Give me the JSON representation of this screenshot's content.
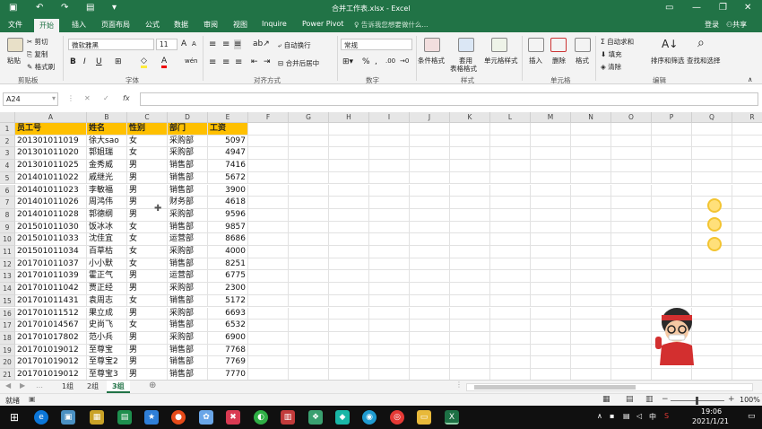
{
  "window": {
    "title": "合并工作表.xlsx - Excel",
    "signin": "登录",
    "share": "共享"
  },
  "tabs": [
    "文件",
    "开始",
    "插入",
    "页面布局",
    "公式",
    "数据",
    "审阅",
    "视图",
    "Inquire",
    "Power Pivot"
  ],
  "active_tab": "开始",
  "tellme_placeholder": "告诉我您想要做什么...",
  "ribbon": {
    "clipboard": {
      "paste": "粘贴",
      "cut": "剪切",
      "copy": "复制",
      "format_painter": "格式刷",
      "group": "剪贴板"
    },
    "font": {
      "name": "微软雅黑",
      "size": "11",
      "bold": "B",
      "italic": "I",
      "underline": "U",
      "fill_letter": "A",
      "group": "字体",
      "grow": "A",
      "shrink": "A",
      "wen": "wén"
    },
    "alignment": {
      "wrap": "自动换行",
      "merge": "合并后居中",
      "group": "对齐方式"
    },
    "number": {
      "format": "常规",
      "group": "数字"
    },
    "styles": {
      "conditional": "条件格式",
      "table1": "套用",
      "table2": "表格格式",
      "cell_styles": "单元格样式",
      "group": "样式"
    },
    "cells": {
      "insert": "插入",
      "delete": "删除",
      "format": "格式",
      "group": "单元格"
    },
    "editing": {
      "autosum": "自动求和",
      "fill": "填充",
      "clear": "清除",
      "sort": "排序和筛选",
      "find": "查找和选择",
      "group": "编辑"
    }
  },
  "formula_bar": {
    "name_box": "A24",
    "value": ""
  },
  "columns": [
    "A",
    "B",
    "C",
    "D",
    "E",
    "F",
    "G",
    "H",
    "I",
    "J",
    "K",
    "L",
    "M",
    "N",
    "O",
    "P",
    "Q",
    "R"
  ],
  "row_numbers": [
    "1",
    "2",
    "3",
    "4",
    "5",
    "6",
    "7",
    "8",
    "9",
    "10",
    "11",
    "12",
    "13",
    "14",
    "15",
    "16",
    "17",
    "18",
    "19",
    "20",
    "21"
  ],
  "table": {
    "headers": [
      "员工号",
      "姓名",
      "性别",
      "部门",
      "工资"
    ],
    "rows": [
      [
        "201301011019",
        "徐大sao",
        "女",
        "采购部",
        "5097"
      ],
      [
        "201301011020",
        "郭姐瑞",
        "女",
        "采购部",
        "4947"
      ],
      [
        "201301011025",
        "金秀威",
        "男",
        "销售部",
        "7416"
      ],
      [
        "201401011022",
        "戚继光",
        "男",
        "销售部",
        "5672"
      ],
      [
        "201401011023",
        "李敏福",
        "男",
        "销售部",
        "3900"
      ],
      [
        "201401011026",
        "周鸿伟",
        "男",
        "财务部",
        "4618"
      ],
      [
        "201401011028",
        "郭德纲",
        "男",
        "采购部",
        "9596"
      ],
      [
        "201501011030",
        "饭冰冰",
        "女",
        "销售部",
        "9857"
      ],
      [
        "201501011033",
        "沈佳宜",
        "女",
        "运营部",
        "8686"
      ],
      [
        "201501011034",
        "百草枯",
        "女",
        "采购部",
        "4000"
      ],
      [
        "201701011037",
        "小小默",
        "女",
        "销售部",
        "8251"
      ],
      [
        "201701011039",
        "霍正气",
        "男",
        "运营部",
        "6775"
      ],
      [
        "201701011042",
        "贾正经",
        "男",
        "采购部",
        "2300"
      ],
      [
        "201701011431",
        "袁周志",
        "女",
        "销售部",
        "5172"
      ],
      [
        "201701011512",
        "果立成",
        "男",
        "采购部",
        "6693"
      ],
      [
        "201701014567",
        "史尚飞",
        "女",
        "销售部",
        "6532"
      ],
      [
        "201701017802",
        "范小兵",
        "男",
        "采购部",
        "6900"
      ],
      [
        "201701019012",
        "至尊宝",
        "男",
        "销售部",
        "7768"
      ],
      [
        "201701019012",
        "至尊宝2",
        "男",
        "销售部",
        "7769"
      ],
      [
        "201701019012",
        "至尊宝3",
        "男",
        "销售部",
        "7770"
      ]
    ]
  },
  "sheets": [
    "1组",
    "2组",
    "3组"
  ],
  "active_sheet": "3组",
  "status": {
    "ready": "就绪",
    "zoom": "100%"
  },
  "taskbar": {
    "time": "19:06",
    "date": "2021/1/21",
    "ime": "中"
  }
}
